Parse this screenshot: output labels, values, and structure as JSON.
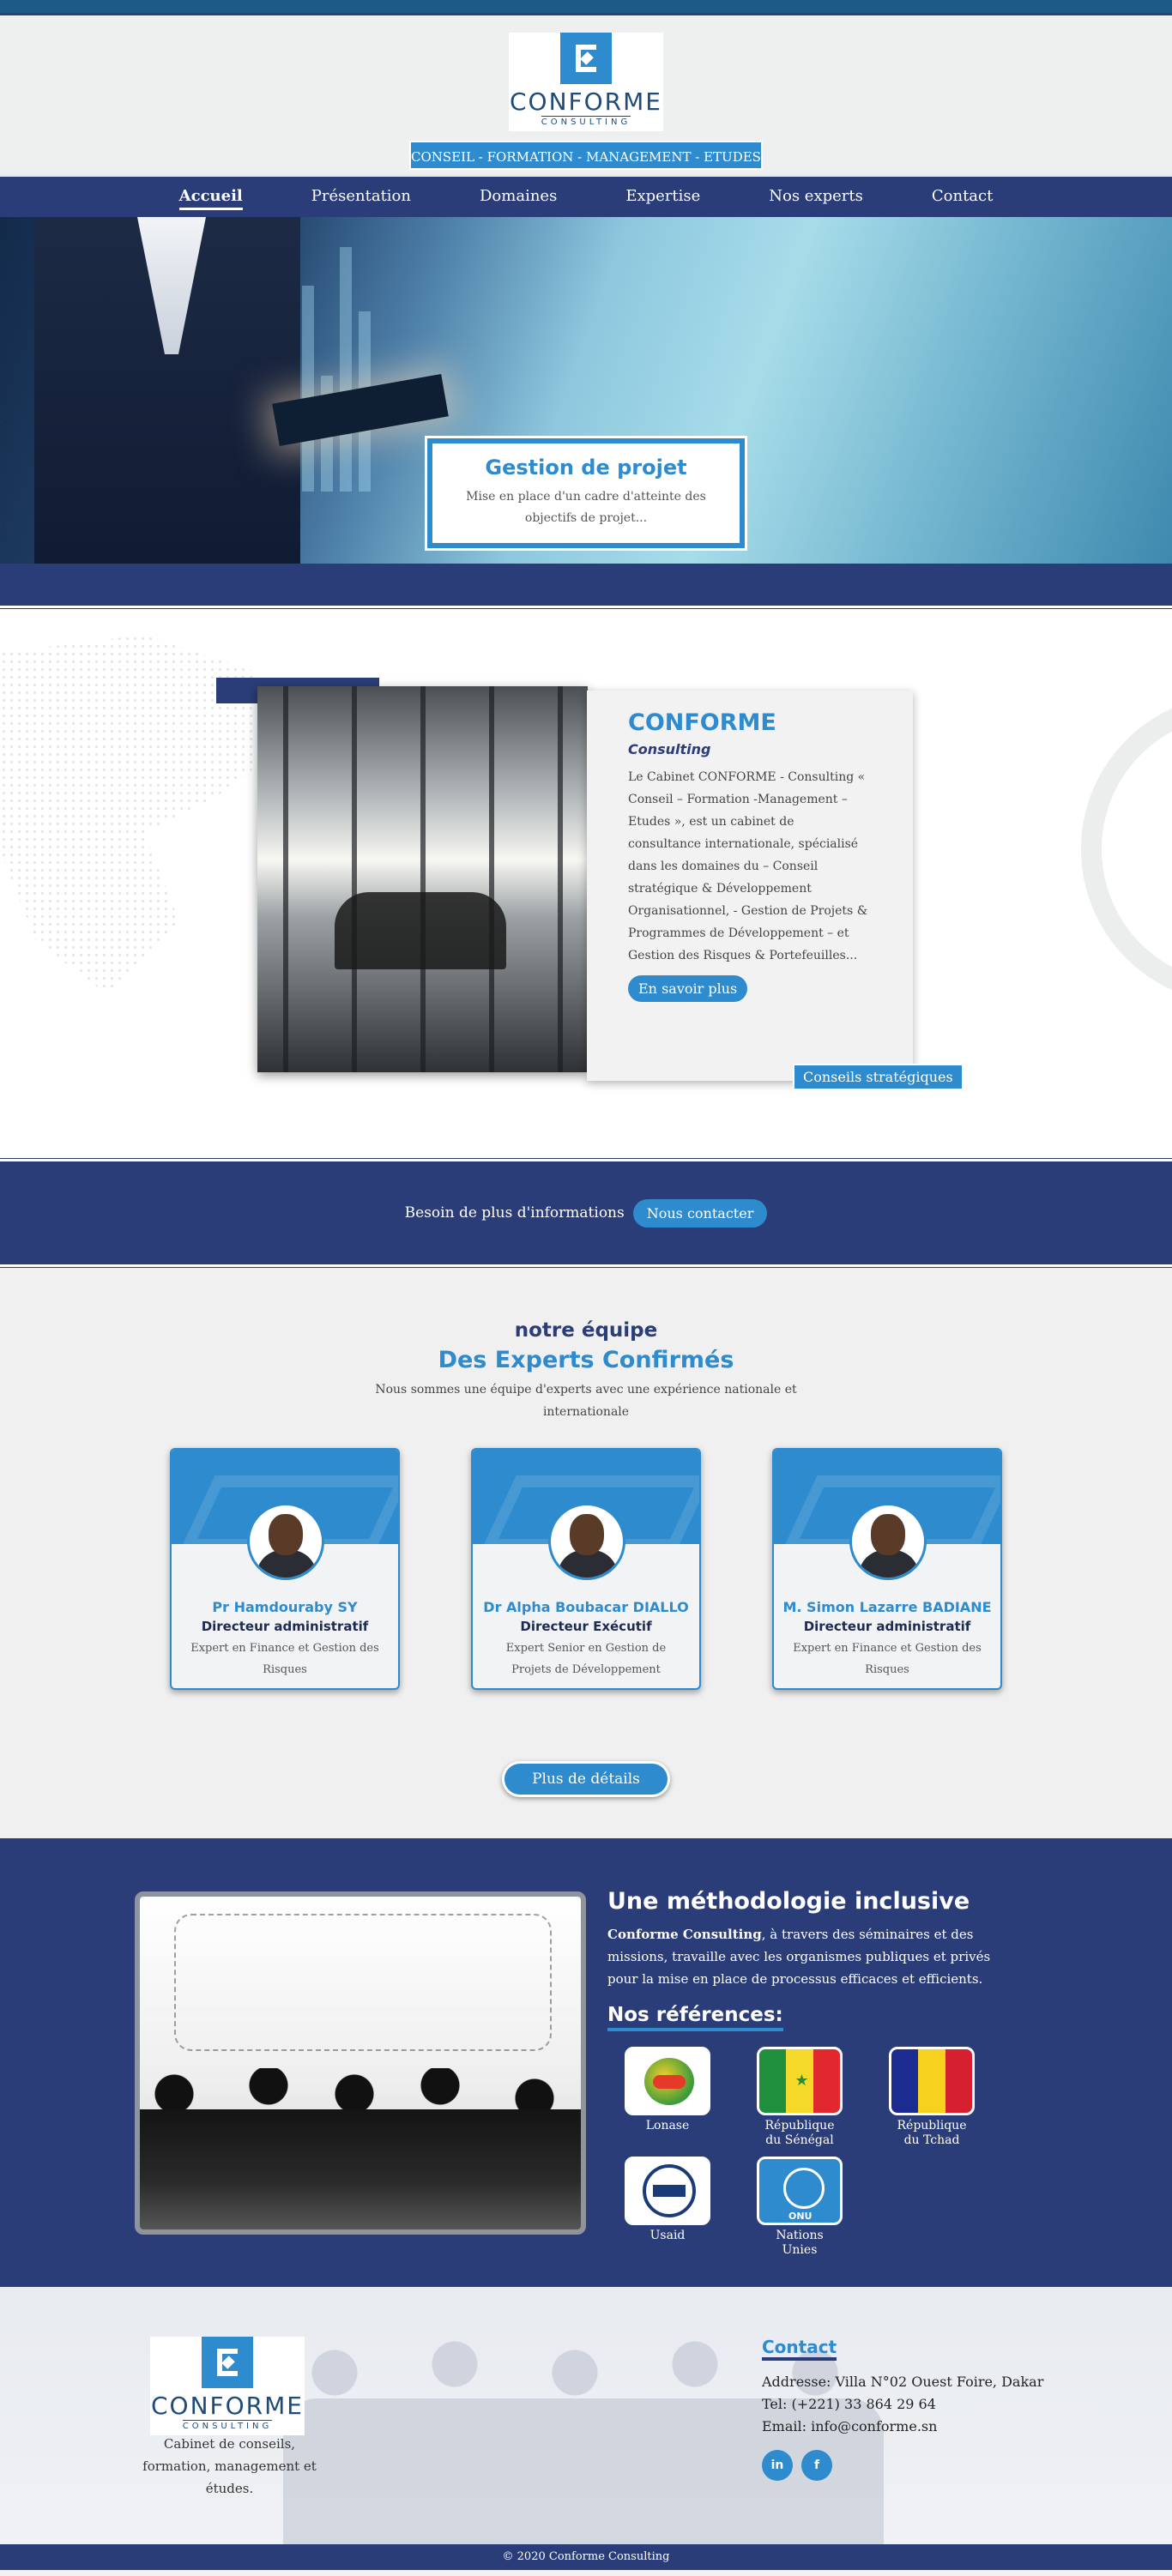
{
  "brand": {
    "name": "CONFORME",
    "sub": "CONSULTING",
    "tagline": "CONSEIL - FORMATION - MANAGEMENT - ETUDES"
  },
  "nav": {
    "items": [
      {
        "label": "Accueil",
        "active": true
      },
      {
        "label": "Présentation"
      },
      {
        "label": "Domaines"
      },
      {
        "label": "Expertise"
      },
      {
        "label": "Nos experts"
      },
      {
        "label": "Contact"
      }
    ]
  },
  "hero": {
    "title": "Gestion de projet",
    "text": "Mise en place d'un cadre d'atteinte des objectifs de projet..."
  },
  "about": {
    "title": "CONFORME",
    "subtitle": "Consulting",
    "text": "Le Cabinet CONFORME - Consulting « Conseil – Formation -Management – Etudes », est un cabinet de consultance internationale, spécialisé dans les domaines du – Conseil stratégique & Développement Organisationnel, - Gestion de Projets & Programmes de Développement – et Gestion des Risques & Portefeuilles...",
    "button": "En savoir plus",
    "tag": "Conseils stratégiques"
  },
  "contact_band": {
    "text": "Besoin de plus d'informations",
    "button": "Nous contacter"
  },
  "team": {
    "kicker": "notre équipe",
    "title": "Des Experts Confirmés",
    "intro": "Nous sommes une équipe d'experts avec une expérience nationale et internationale",
    "members": [
      {
        "name": "Pr Hamdouraby SY",
        "role": "Directeur administratif",
        "desc": "Expert en Finance et Gestion des Risques"
      },
      {
        "name": "Dr Alpha Boubacar DIALLO",
        "role": "Directeur Exécutif",
        "desc": "Expert Senior en Gestion de Projets de Développement"
      },
      {
        "name": "M. Simon Lazarre BADIANE",
        "role": "Directeur administratif",
        "desc": "Expert en Finance et Gestion des Risques"
      }
    ],
    "more": "Plus de détails"
  },
  "method": {
    "title": "Une méthodologie inclusive",
    "lead_bold": "Conforme Consulting",
    "lead_rest": ", à travers des séminaires et des missions, travaille avec les organismes publiques et privés pour la mise en place de processus efficaces et efficients.",
    "refs_title": "Nos références:",
    "refs": [
      {
        "label": "Lonase"
      },
      {
        "label": "République du Sénégal"
      },
      {
        "label": "République du Tchad"
      },
      {
        "label": "Usaid"
      },
      {
        "label": "Nations Unies"
      }
    ]
  },
  "footer": {
    "desc": "Cabinet de conseils, formation, management et études.",
    "contact_title": "Contact",
    "address": "Addresse: Villa N°02 Ouest Foire, Dakar",
    "tel": "Tel: (+221) 33 864 29 64",
    "email": "Email: info@conforme.sn",
    "socials": [
      "in",
      "f"
    ],
    "copyright": "© 2020 Conforme Consulting"
  },
  "colors": {
    "navy": "#2a3d78",
    "blue": "#2e8bce",
    "top_strip": "#1e5a86"
  }
}
